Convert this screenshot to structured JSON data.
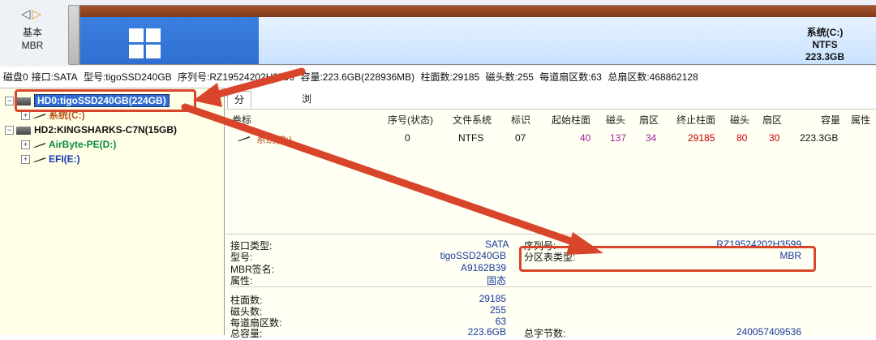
{
  "topbar": {
    "nav": "◁ ▷",
    "disk_kind_line1": "基本",
    "disk_kind_line2": "MBR",
    "partition_name": "系统(C:)",
    "partition_fs": "NTFS",
    "partition_size": "223.3GB",
    "colors": {
      "used": "#2f6fd2",
      "free": "#d7e9ff",
      "stripe": "#8b431f"
    }
  },
  "disk_info": {
    "disk": "磁盘0",
    "interface": "接口:SATA",
    "model": "型号:tigoSSD240GB",
    "serial": "序列号:RZ19524202H3599",
    "capacity": "容量:223.6GB(228936MB)",
    "cylinders": "柱面数:29185",
    "heads": "磁头数:255",
    "sectors_per_track": "每道扇区数:63",
    "total_sectors": "总扇区数:468862128"
  },
  "tree": {
    "hd0": "HD0:tigoSSD240GB(224GB)",
    "hd0_part": "系统(C:)",
    "hd2": "HD2:KINGSHARKS-C7N(15GB)",
    "hd2_part1": "AirByte-PE(D:)",
    "hd2_part2": "EFI(E:)"
  },
  "tabs": [
    "分区参数",
    "浏览文件"
  ],
  "grid": {
    "headers": [
      "卷标",
      "序号(状态)",
      "文件系统",
      "标识",
      "起始柱面",
      "磁头",
      "扇区",
      "终止柱面",
      "磁头",
      "扇区",
      "容量",
      "属性"
    ],
    "row": {
      "label": "系统(C:)",
      "index": "0",
      "fs": "NTFS",
      "id": "07",
      "start_cyl": "40",
      "start_head": "137",
      "start_sector": "34",
      "end_cyl": "29185",
      "end_head": "80",
      "end_sector": "30",
      "capacity": "223.3GB"
    }
  },
  "details": {
    "interface_label": "接口类型:",
    "interface_value": "SATA",
    "model_label": "型号:",
    "model_value": "tigoSSD240GB",
    "mbr_sig_label": "MBR签名:",
    "mbr_sig_value": "A9162B39",
    "attr_label": "属性:",
    "attr_value": "固态",
    "serial_label": "序列号:",
    "serial_value": "RZ19524202H3599",
    "pt_type_label": "分区表类型:",
    "pt_type_value": "MBR",
    "cyl_label": "柱面数:",
    "cyl_value": "29185",
    "heads_label": "磁头数:",
    "heads_value": "255",
    "spt_label": "每道扇区数:",
    "spt_value": "63",
    "total_cap_label": "总容量:",
    "total_cap_value": "223.6GB",
    "total_bytes_label": "总字节数:",
    "total_bytes_value": "240057409536"
  },
  "annotation": {
    "color": "#d8452a"
  }
}
